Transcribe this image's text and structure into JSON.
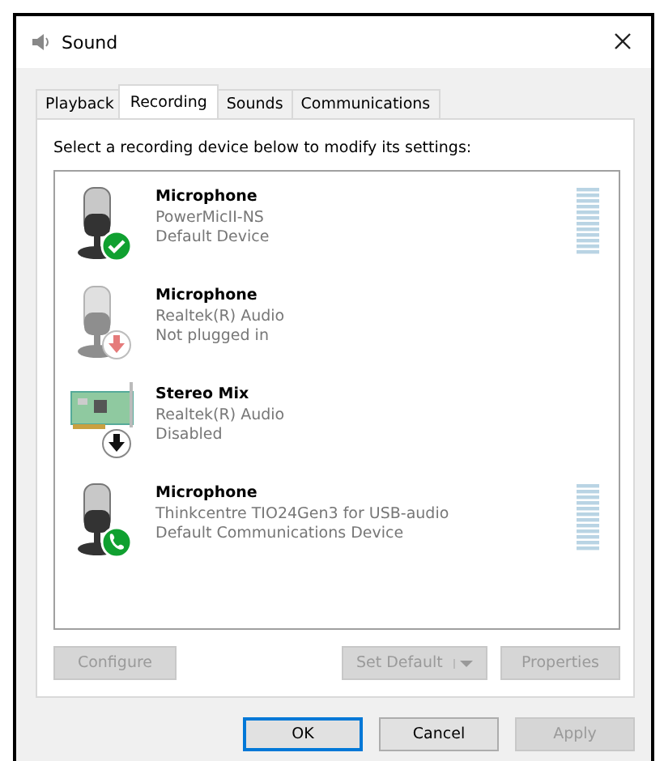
{
  "window": {
    "title": "Sound"
  },
  "tabs": [
    {
      "label": "Playback",
      "selected": false
    },
    {
      "label": "Recording",
      "selected": true
    },
    {
      "label": "Sounds",
      "selected": false
    },
    {
      "label": "Communications",
      "selected": false
    }
  ],
  "instruction": "Select a recording device below to modify its settings:",
  "devices": [
    {
      "kind": "microphone-default",
      "name": "Microphone",
      "driver": "PowerMicII-NS",
      "status": "Default Device",
      "meter": true,
      "dimmed": false
    },
    {
      "kind": "microphone-unplugged",
      "name": "Microphone",
      "driver": "Realtek(R) Audio",
      "status": "Not plugged in",
      "meter": false,
      "dimmed": true
    },
    {
      "kind": "card-disabled",
      "name": "Stereo Mix",
      "driver": "Realtek(R) Audio",
      "status": "Disabled",
      "meter": false,
      "dimmed": false
    },
    {
      "kind": "microphone-communications",
      "name": "Microphone",
      "driver": "Thinkcentre TIO24Gen3 for USB-audio",
      "status": "Default Communications Device",
      "meter": true,
      "dimmed": false
    }
  ],
  "device_buttons": [
    {
      "label": "Configure",
      "disabled": true
    },
    {
      "label": "Set Default",
      "disabled": true,
      "dropdown": true
    },
    {
      "label": "Properties",
      "disabled": true
    }
  ],
  "dialog_buttons": [
    {
      "label": "OK",
      "disabled": false,
      "default": true
    },
    {
      "label": "Cancel",
      "disabled": false,
      "default": false
    },
    {
      "label": "Apply",
      "disabled": true,
      "default": false
    }
  ]
}
